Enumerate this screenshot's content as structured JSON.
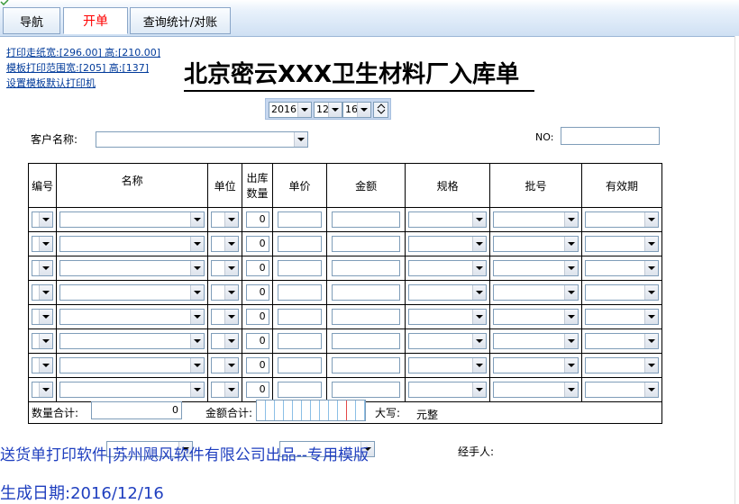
{
  "tabs": [
    {
      "label": "导航"
    },
    {
      "label": "开单"
    },
    {
      "label": "查询统计/对账"
    }
  ],
  "accent_color": "#ff0000",
  "links": {
    "paper_size": "打印走纸宽:[296.00] 高:[210.00]",
    "template_range": "模板打印范围宽:[205] 高:[137]",
    "default_printer": "设置模板默认打印机"
  },
  "form": {
    "title": "北京密云XXX卫生材料厂入库单",
    "date": {
      "year": "2016",
      "month": "12",
      "day": "16"
    },
    "customer_label": "客户名称:",
    "customer_value": "",
    "no_label": "NO:",
    "no_value": ""
  },
  "table": {
    "headers": [
      "编号",
      "名称",
      "单位",
      "出库\n数量",
      "单价",
      "金额",
      "规格",
      "批号",
      "有效期"
    ],
    "qty_header_line1": "出库",
    "qty_header_line2": "数量",
    "rows": [
      {
        "qty": "0"
      },
      {
        "qty": "0"
      },
      {
        "qty": "0"
      },
      {
        "qty": "0"
      },
      {
        "qty": "0"
      },
      {
        "qty": "0"
      },
      {
        "qty": "0"
      },
      {
        "qty": "0"
      }
    ],
    "qty_total_label": "数量合计:",
    "qty_total_value": "0",
    "amount_total_label": "金额合计:",
    "uppercase_label": "大写:",
    "uppercase_value": "元整"
  },
  "footer": {
    "watermark": "送货单打印软件|苏州飓风软件有限公司出品--专用模版",
    "gen_date": "生成日期:2016/12/16",
    "handler_label": "经手人:"
  }
}
